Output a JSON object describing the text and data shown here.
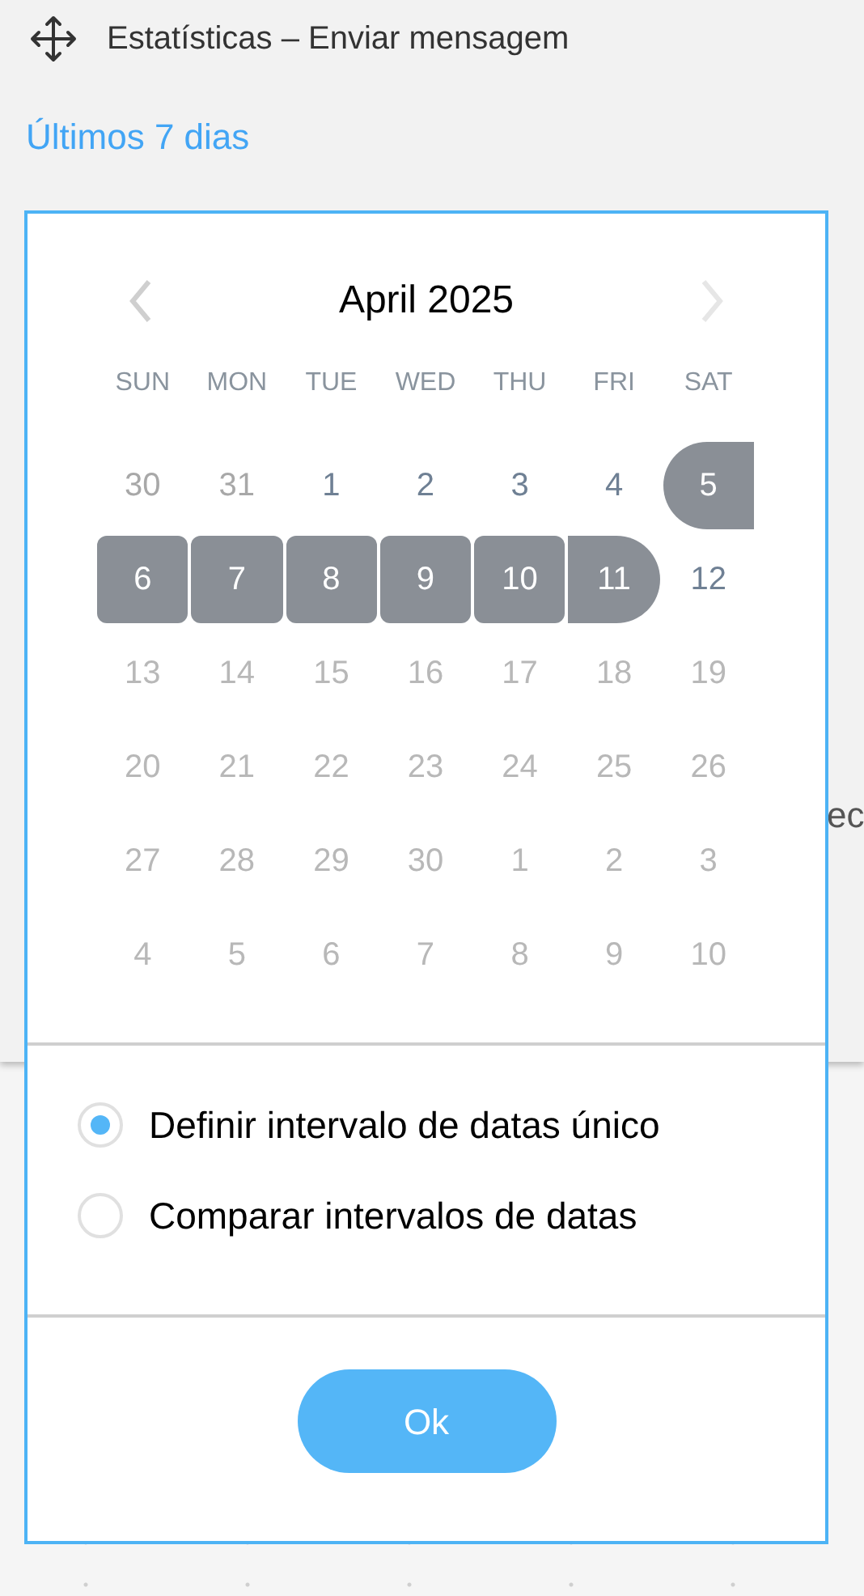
{
  "header": {
    "title": "Estatísticas – Enviar mensagem"
  },
  "range_link": "Últimos 7 dias",
  "background_text": "ec",
  "calendar": {
    "month": "April 2025",
    "prev_disabled": false,
    "next_disabled": true,
    "weekdays": [
      "SUN",
      "MON",
      "TUE",
      "WED",
      "THU",
      "FRI",
      "SAT"
    ],
    "days": [
      {
        "label": "30",
        "kind": "outside",
        "selected": false
      },
      {
        "label": "31",
        "kind": "outside",
        "selected": false
      },
      {
        "label": "1",
        "kind": "available",
        "selected": false
      },
      {
        "label": "2",
        "kind": "available",
        "selected": false
      },
      {
        "label": "3",
        "kind": "available",
        "selected": false
      },
      {
        "label": "4",
        "kind": "available",
        "selected": false
      },
      {
        "label": "5",
        "kind": "available",
        "selected": true
      },
      {
        "label": "6",
        "kind": "available",
        "selected": true
      },
      {
        "label": "7",
        "kind": "available",
        "selected": true
      },
      {
        "label": "8",
        "kind": "available",
        "selected": true
      },
      {
        "label": "9",
        "kind": "available",
        "selected": true
      },
      {
        "label": "10",
        "kind": "available",
        "selected": true
      },
      {
        "label": "11",
        "kind": "available",
        "selected": true
      },
      {
        "label": "12",
        "kind": "available",
        "selected": false
      },
      {
        "label": "13",
        "kind": "unavailable",
        "selected": false
      },
      {
        "label": "14",
        "kind": "unavailable",
        "selected": false
      },
      {
        "label": "15",
        "kind": "unavailable",
        "selected": false
      },
      {
        "label": "16",
        "kind": "unavailable",
        "selected": false
      },
      {
        "label": "17",
        "kind": "unavailable",
        "selected": false
      },
      {
        "label": "18",
        "kind": "unavailable",
        "selected": false
      },
      {
        "label": "19",
        "kind": "unavailable",
        "selected": false
      },
      {
        "label": "20",
        "kind": "unavailable",
        "selected": false
      },
      {
        "label": "21",
        "kind": "unavailable",
        "selected": false
      },
      {
        "label": "22",
        "kind": "unavailable",
        "selected": false
      },
      {
        "label": "23",
        "kind": "unavailable",
        "selected": false
      },
      {
        "label": "24",
        "kind": "unavailable",
        "selected": false
      },
      {
        "label": "25",
        "kind": "unavailable",
        "selected": false
      },
      {
        "label": "26",
        "kind": "unavailable",
        "selected": false
      },
      {
        "label": "27",
        "kind": "unavailable",
        "selected": false
      },
      {
        "label": "28",
        "kind": "unavailable",
        "selected": false
      },
      {
        "label": "29",
        "kind": "unavailable",
        "selected": false
      },
      {
        "label": "30",
        "kind": "unavailable",
        "selected": false
      },
      {
        "label": "1",
        "kind": "unavailable",
        "selected": false
      },
      {
        "label": "2",
        "kind": "unavailable",
        "selected": false
      },
      {
        "label": "3",
        "kind": "unavailable",
        "selected": false
      },
      {
        "label": "4",
        "kind": "unavailable",
        "selected": false
      },
      {
        "label": "5",
        "kind": "unavailable",
        "selected": false
      },
      {
        "label": "6",
        "kind": "unavailable",
        "selected": false
      },
      {
        "label": "7",
        "kind": "unavailable",
        "selected": false
      },
      {
        "label": "8",
        "kind": "unavailable",
        "selected": false
      },
      {
        "label": "9",
        "kind": "unavailable",
        "selected": false
      },
      {
        "label": "10",
        "kind": "unavailable",
        "selected": false
      }
    ]
  },
  "options": [
    {
      "label": "Definir intervalo de datas único",
      "selected": true
    },
    {
      "label": "Comparar intervalos de datas",
      "selected": false
    }
  ],
  "ok_button": "Ok"
}
